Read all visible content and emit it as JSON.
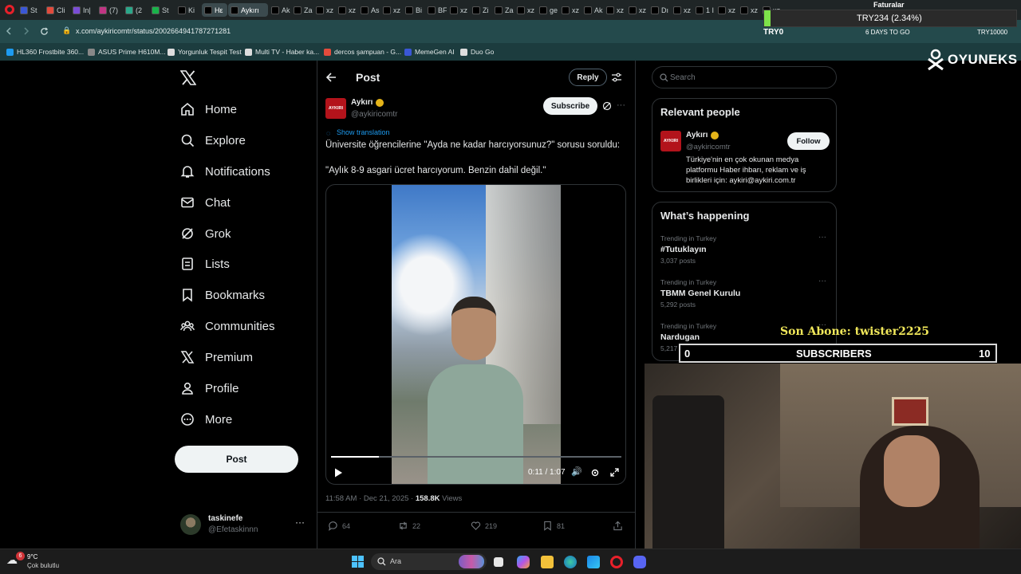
{
  "browser": {
    "tabs": [
      "St",
      "Cli",
      "In|",
      "(7)",
      "(2",
      "St",
      "Ki",
      "Hε",
      "Aykırı",
      "Ak",
      "Za",
      "xz",
      "xz",
      "As",
      "xz",
      "Bi",
      "BF",
      "xz",
      "Zi",
      "Za",
      "xz",
      "ge",
      "xz",
      "Ak",
      "xz",
      "xz",
      "Dı",
      "xz",
      "1 I",
      "xz",
      "xz",
      "xz"
    ],
    "url": "x.com/aykiricomtr/status/2002664941787271281",
    "bookmarks": [
      "HL360 Frostbite 360...",
      "ASUS Prime H610M...",
      "Yorgunluk Tespit Test",
      "Multi TV - Haber ka...",
      "dercos şampuan - G...",
      "MemeGen AI",
      "Duo Go"
    ]
  },
  "stream_overlay": {
    "ticker_title": "Faturalar",
    "ticker_value": "TRY234 (2.34%)",
    "ticker_left": "TRY0",
    "ticker_days": "6 DAYS TO GO",
    "ticker_right": "TRY10000",
    "brand": "OYUNEKS",
    "last_sub_label": "Son Abone: twister2225",
    "sub_left": "0",
    "sub_label": "SUBSCRIBERS",
    "sub_right": "10"
  },
  "sidebar": {
    "items": [
      {
        "label": "Home",
        "icon": "home-icon"
      },
      {
        "label": "Explore",
        "icon": "search-icon"
      },
      {
        "label": "Notifications",
        "icon": "bell-icon"
      },
      {
        "label": "Chat",
        "icon": "mail-icon"
      },
      {
        "label": "Grok",
        "icon": "grok-icon"
      },
      {
        "label": "Lists",
        "icon": "list-icon"
      },
      {
        "label": "Bookmarks",
        "icon": "bookmark-icon"
      },
      {
        "label": "Communities",
        "icon": "communities-icon"
      },
      {
        "label": "Premium",
        "icon": "x-logo-icon"
      },
      {
        "label": "Profile",
        "icon": "person-icon"
      },
      {
        "label": "More",
        "icon": "more-circle-icon"
      }
    ],
    "post_button": "Post",
    "account_name": "taskinefe",
    "account_handle": "@Efetaskinnn"
  },
  "post": {
    "header_title": "Post",
    "reply_button": "Reply",
    "author_name": "Aykırı",
    "author_handle": "@aykiricomtr",
    "avatar_text": "AYKIRI",
    "subscribe_button": "Subscribe",
    "show_translation": "Show translation",
    "text1": "Üniversite öğrencilerine \"Ayda ne kadar harcıyorsunuz?\" sorusu soruldu:",
    "text2": "\"Aylık 8-9 asgari ücret harcıyorum. Benzin dahil değil.\"",
    "video_time": "0:11 / 1:07",
    "video_progress": 0.164,
    "timestamp": "11:58 AM · Dec 21, 2025 · ",
    "views_count": "158.8K",
    "views_label": " Views",
    "replies": "64",
    "reposts": "22",
    "likes": "219",
    "bookmarks": "81"
  },
  "right": {
    "search_placeholder": "Search",
    "relevant_title": "Relevant people",
    "rp_name": "Aykırı",
    "rp_handle": "@aykiricomtr",
    "rp_follow": "Follow",
    "rp_bio": "Türkiye'nin en çok okunan medya platformu Haber ihbarı, reklam ve iş birlikleri için: aykiri@aykiri.com.tr",
    "happening_title": "What’s happening",
    "trends": [
      {
        "sub": "Trending in Turkey",
        "title": "#Tutuklayın",
        "posts": "3,037 posts"
      },
      {
        "sub": "Trending in Turkey",
        "title": "TBMM Genel Kurulu",
        "posts": "5,292 posts"
      },
      {
        "sub": "Trending in Turkey",
        "title": "Nardugan",
        "posts": "5,217 posts"
      }
    ]
  },
  "taskbar": {
    "weather_temp": "9°C",
    "weather_desc": "Çok bulutlu",
    "weather_badge": "6",
    "search_label": "Ara"
  }
}
